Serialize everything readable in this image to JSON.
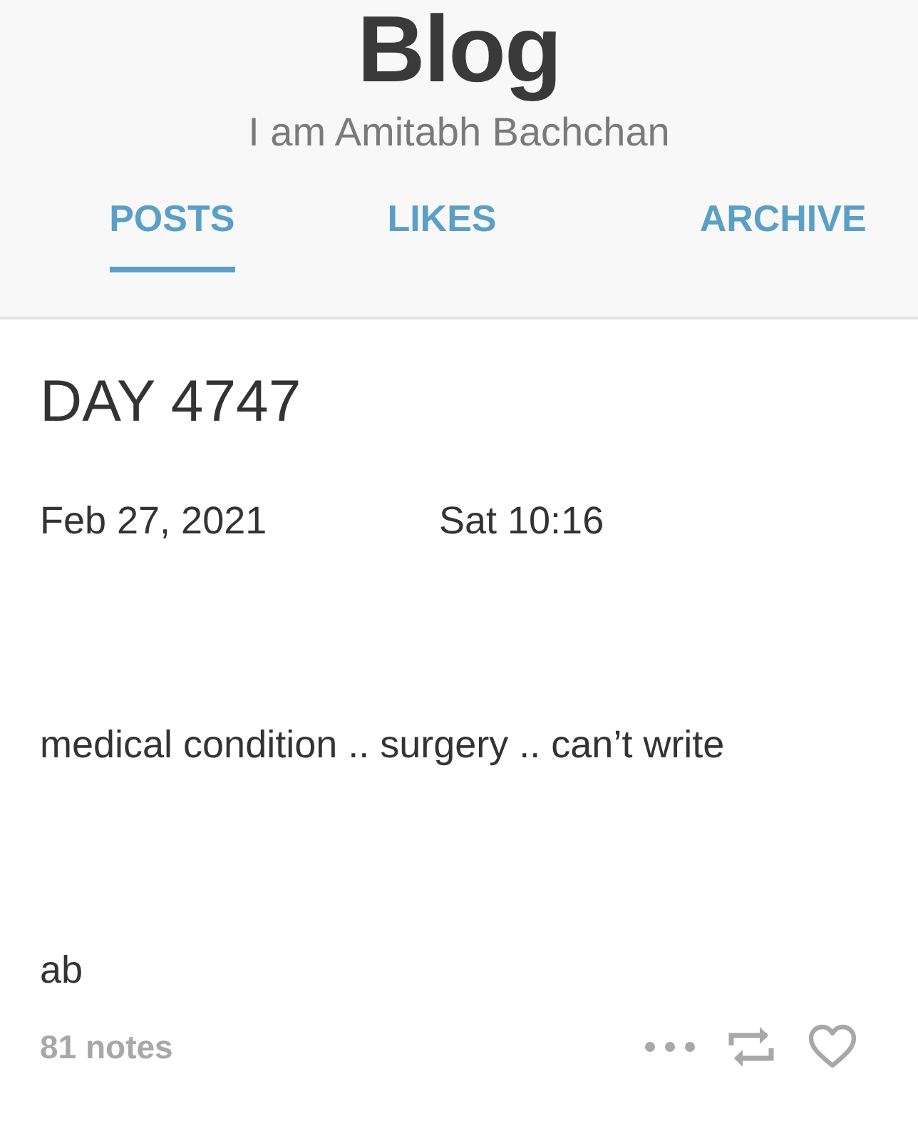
{
  "header": {
    "title": "Blog",
    "subtitle": "I am Amitabh Bachchan"
  },
  "tabs": [
    {
      "label": "POSTS",
      "selected": true
    },
    {
      "label": "LIKES",
      "selected": false
    },
    {
      "label": "ARCHIVE",
      "selected": false
    }
  ],
  "post": {
    "title": "DAY 4747",
    "date": "Feb 27, 2021",
    "time": "Sat 10:16",
    "paragraphs": [
      "medical condition .. surgery .. can’t write",
      "ab"
    ],
    "notes": "81 notes"
  }
}
